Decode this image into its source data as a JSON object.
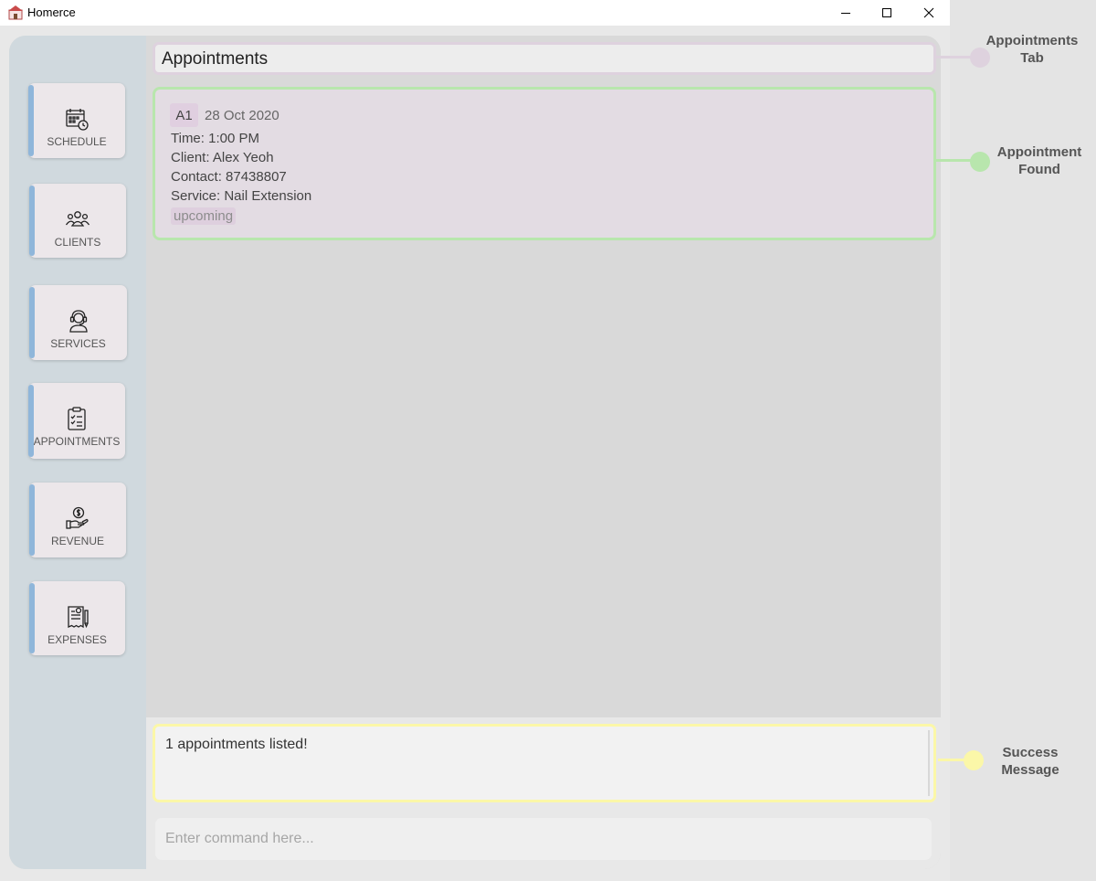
{
  "window": {
    "title": "Homerce",
    "controls": [
      "minimize-icon",
      "maximize-icon",
      "close-icon"
    ]
  },
  "sidebar": {
    "items": [
      {
        "label": "SCHEDULE",
        "icon": "calendar-clock-icon"
      },
      {
        "label": "CLIENTS",
        "icon": "people-group-icon"
      },
      {
        "label": "SERVICES",
        "icon": "headset-person-icon"
      },
      {
        "label": "APPOINTMENTS",
        "icon": "clipboard-checklist-icon"
      },
      {
        "label": "REVENUE",
        "icon": "hand-coin-icon"
      },
      {
        "label": "EXPENSES",
        "icon": "receipt-pen-icon"
      }
    ],
    "accent_color": "#8fb6da"
  },
  "main": {
    "tab_title": "Appointments",
    "appointments": [
      {
        "id": "A1",
        "date": "28 Oct 2020",
        "time": "Time: 1:00 PM",
        "client": "Client: Alex Yeoh",
        "contact": "Contact: 87438807",
        "service": "Service: Nail Extension",
        "status": "upcoming"
      }
    ]
  },
  "result": {
    "message": "1 appointments listed!"
  },
  "command": {
    "placeholder": "Enter command here..."
  },
  "annotations": [
    {
      "label_line1": "Appointments",
      "label_line2": "Tab",
      "color": "#ded2de"
    },
    {
      "label_line1": "Appointment",
      "label_line2": "Found",
      "color": "#b8e6ad"
    },
    {
      "label_line1": "Success",
      "label_line2": "Message",
      "color": "#fbf7a8"
    }
  ]
}
